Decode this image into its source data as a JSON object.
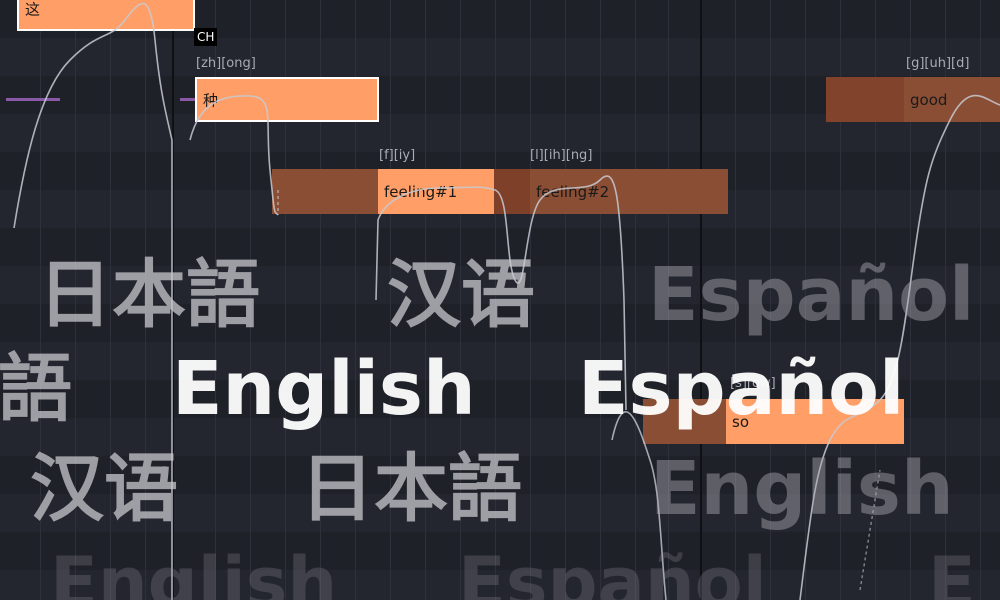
{
  "notes": [
    {
      "lyric": "这"
    },
    {
      "lyric": "种",
      "phonemes": "[zh][ong]"
    },
    {
      "lyric": "feeling#1",
      "phonemes": "[f][iy]"
    },
    {
      "lyric": "feeling#2",
      "phonemes": "[l][ih][ng]"
    },
    {
      "lyric": "good",
      "phonemes": "[g][uh][d]"
    },
    {
      "lyric": "so",
      "phonemes": "[s][ow]"
    }
  ],
  "language_tag": "CH",
  "overlay_words": {
    "row1": [
      "日本語",
      "汉语",
      "Español"
    ],
    "row2": [
      "語",
      "English",
      "Español"
    ],
    "row3": [
      "汉语",
      "日本語",
      "English"
    ],
    "row4": [
      "English",
      "Español",
      "E"
    ]
  }
}
